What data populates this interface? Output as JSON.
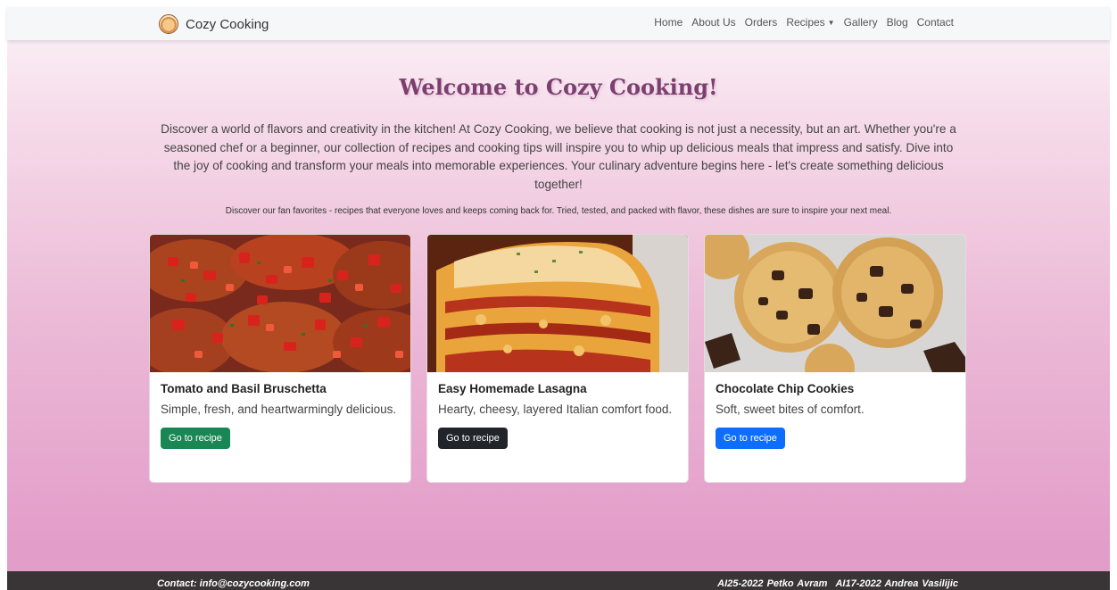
{
  "navbar": {
    "brand": "Cozy Cooking",
    "links": [
      "Home",
      "About Us",
      "Orders",
      "Recipes",
      "Gallery",
      "Blog",
      "Contact"
    ]
  },
  "hero": {
    "title": "Welcome to Cozy Cooking!",
    "text": "Discover a world of flavors and creativity in the kitchen! At Cozy Cooking, we believe that cooking is not just a necessity, but an art. Whether you're a seasoned chef or a beginner, our collection of recipes and cooking tips will inspire you to whip up delicious meals that impress and satisfy. Dive into the joy of cooking and transform your meals into memorable experiences. Your culinary adventure begins here - let's create something delicious together!",
    "subtext": "Discover our fan favorites - recipes that everyone loves and keeps coming back for. Tried, tested, and packed with flavor, these dishes are sure to inspire your next meal."
  },
  "cards": [
    {
      "title": "Tomato and Basil Bruschetta",
      "text": "Simple, fresh, and heartwarmingly delicious.",
      "button": "Go to recipe",
      "button_color": "#198754"
    },
    {
      "title": "Easy Homemade Lasagna",
      "text": "Hearty, cheesy, layered Italian comfort food.",
      "button": "Go to recipe",
      "button_color": "#212529"
    },
    {
      "title": "Chocolate Chip Cookies",
      "text": "Soft, sweet bites of comfort.",
      "button": "Go to recipe",
      "button_color": "#0d6efd"
    }
  ],
  "footer": {
    "contact": "Contact: info@cozycooking.com",
    "author1": "AI25-2022 Petko Avram",
    "author2": "AI17-2022 Andrea Vasilijic"
  },
  "colors": {
    "accent": "#7c3f6e",
    "footer_bg": "#393436",
    "navbar_bg": "#f6f7f9"
  }
}
